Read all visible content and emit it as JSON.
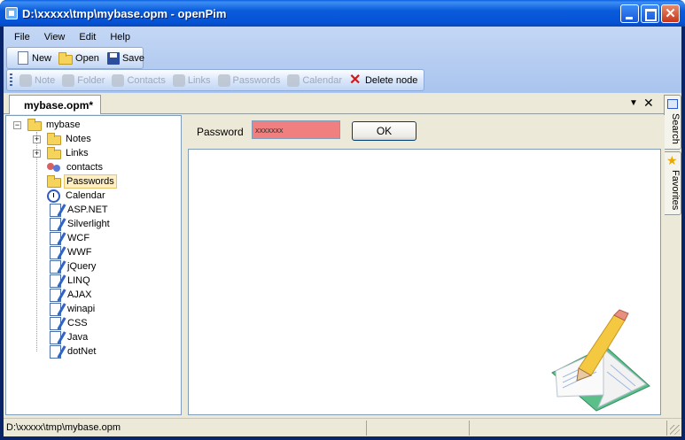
{
  "window": {
    "title": "D:\\xxxxx\\tmp\\mybase.opm - openPim"
  },
  "menu": [
    "File",
    "View",
    "Edit",
    "Help"
  ],
  "toolbar_main": {
    "new": "New",
    "open": "Open",
    "save": "Save"
  },
  "toolbar_nodes": {
    "note": "Note",
    "folder": "Folder",
    "contacts": "Contacts",
    "links": "Links",
    "passwords": "Passwords",
    "calendar": "Calendar",
    "delete": "Delete node"
  },
  "doc_tab": "mybase.opm*",
  "side_tabs": {
    "search": "Search",
    "favorites": "Favorites"
  },
  "tree": {
    "root": "mybase",
    "items": [
      {
        "label": "Notes",
        "icon": "folder-icon",
        "expandable": true
      },
      {
        "label": "Links",
        "icon": "folder-icon",
        "expandable": true
      },
      {
        "label": "contacts",
        "icon": "contacts-icon",
        "expandable": false
      },
      {
        "label": "Passwords",
        "icon": "folder-icon",
        "expandable": false,
        "selected": true
      },
      {
        "label": "Calendar",
        "icon": "calendar-icon",
        "expandable": false
      },
      {
        "label": "ASP.NET",
        "icon": "note-icon",
        "expandable": false
      },
      {
        "label": "Silverlight",
        "icon": "note-icon",
        "expandable": false
      },
      {
        "label": "WCF",
        "icon": "note-icon",
        "expandable": false
      },
      {
        "label": "WWF",
        "icon": "note-icon",
        "expandable": false
      },
      {
        "label": "jQuery",
        "icon": "note-icon",
        "expandable": false
      },
      {
        "label": "LINQ",
        "icon": "note-icon",
        "expandable": false
      },
      {
        "label": "AJAX",
        "icon": "note-icon",
        "expandable": false
      },
      {
        "label": "winapi",
        "icon": "note-icon",
        "expandable": false
      },
      {
        "label": "CSS",
        "icon": "note-icon",
        "expandable": false
      },
      {
        "label": "Java",
        "icon": "note-icon",
        "expandable": false
      },
      {
        "label": "dotNet",
        "icon": "note-icon",
        "expandable": false
      }
    ]
  },
  "password_panel": {
    "label": "Password",
    "value": "xxxxxxx",
    "ok": "OK"
  },
  "status": {
    "path": "D:\\xxxxx\\tmp\\mybase.opm"
  },
  "colors": {
    "titlebar": "#0553D6",
    "password_field": "#F08080"
  }
}
